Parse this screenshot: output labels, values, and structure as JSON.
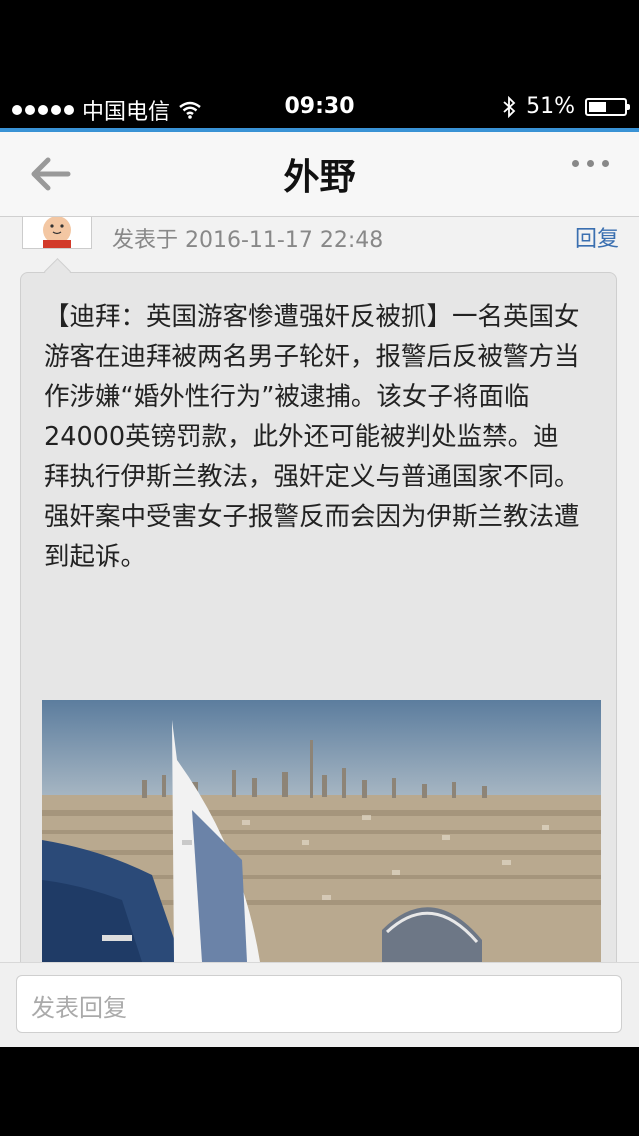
{
  "status_bar": {
    "carrier": "中国电信",
    "time": "09:30",
    "battery": "51%",
    "battery_level": 0.51
  },
  "nav": {
    "title": "外野",
    "back_icon": "arrow-left-icon",
    "more_icon": "ellipsis-icon"
  },
  "post": {
    "meta": "发表于 2016-11-17 22:48",
    "reply_label": "回复",
    "text": "【迪拜：英国游客惨遭强奸反被抓】一名英国女游客在迪拜被两名男子轮奸，报警后反被警方当作涉嫌“婚外性行为”被逮捕。该女子将面临24000英镑罚款，此外还可能被判处监禁。迪拜执行伊斯兰教法，强奸定义与普通国家不同。强奸案中受害女子报警反而会因为伊斯兰教法遭到起诉。"
  },
  "footer": {
    "reply_placeholder": "发表回复"
  },
  "colors": {
    "accent": "#3a93d6",
    "link": "#3a6fb0"
  }
}
